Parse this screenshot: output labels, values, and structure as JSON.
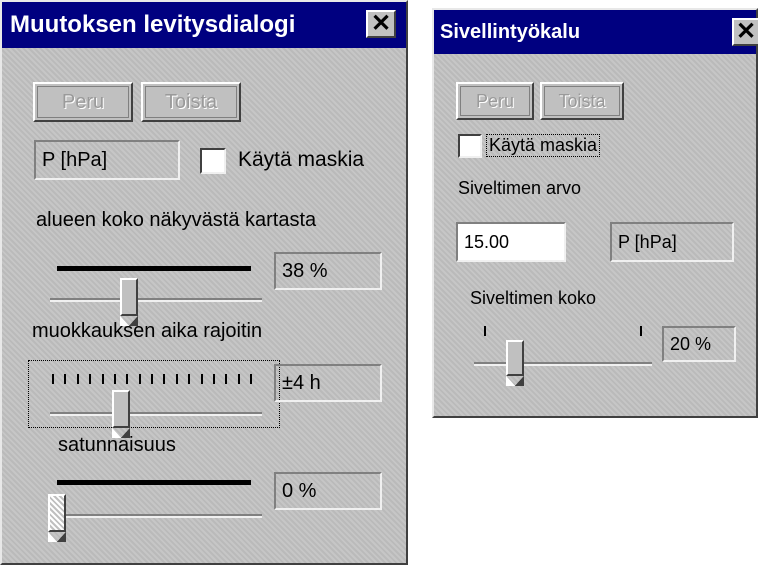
{
  "dialog1": {
    "title": "Muutoksen levitysdialogi",
    "close_label": "✕",
    "cancel_label": "Peru",
    "redo_label": "Toista",
    "parameter": "P [hPa]",
    "use_mask_label": "Käytä maskia",
    "use_mask_checked": false,
    "area_label": "alueen koko näkyvästä kartasta",
    "area_value": "38 %",
    "area_fraction": 0.38,
    "time_label": "muokkauksen aika rajoitin",
    "time_value": "±4 h",
    "randomness_label": "satunnaisuus",
    "randomness_value": "0 %"
  },
  "dialog2": {
    "title": "Sivellintyökalu",
    "close_label": "✕",
    "cancel_label": "Peru",
    "redo_label": "Toista",
    "use_mask_label": "Käytä maskia",
    "use_mask_checked": false,
    "brush_value_label": "Siveltimen arvo",
    "brush_value": "15.00",
    "parameter": "P [hPa]",
    "brush_size_label": "Siveltimen koko",
    "brush_size_value": "20 %"
  }
}
